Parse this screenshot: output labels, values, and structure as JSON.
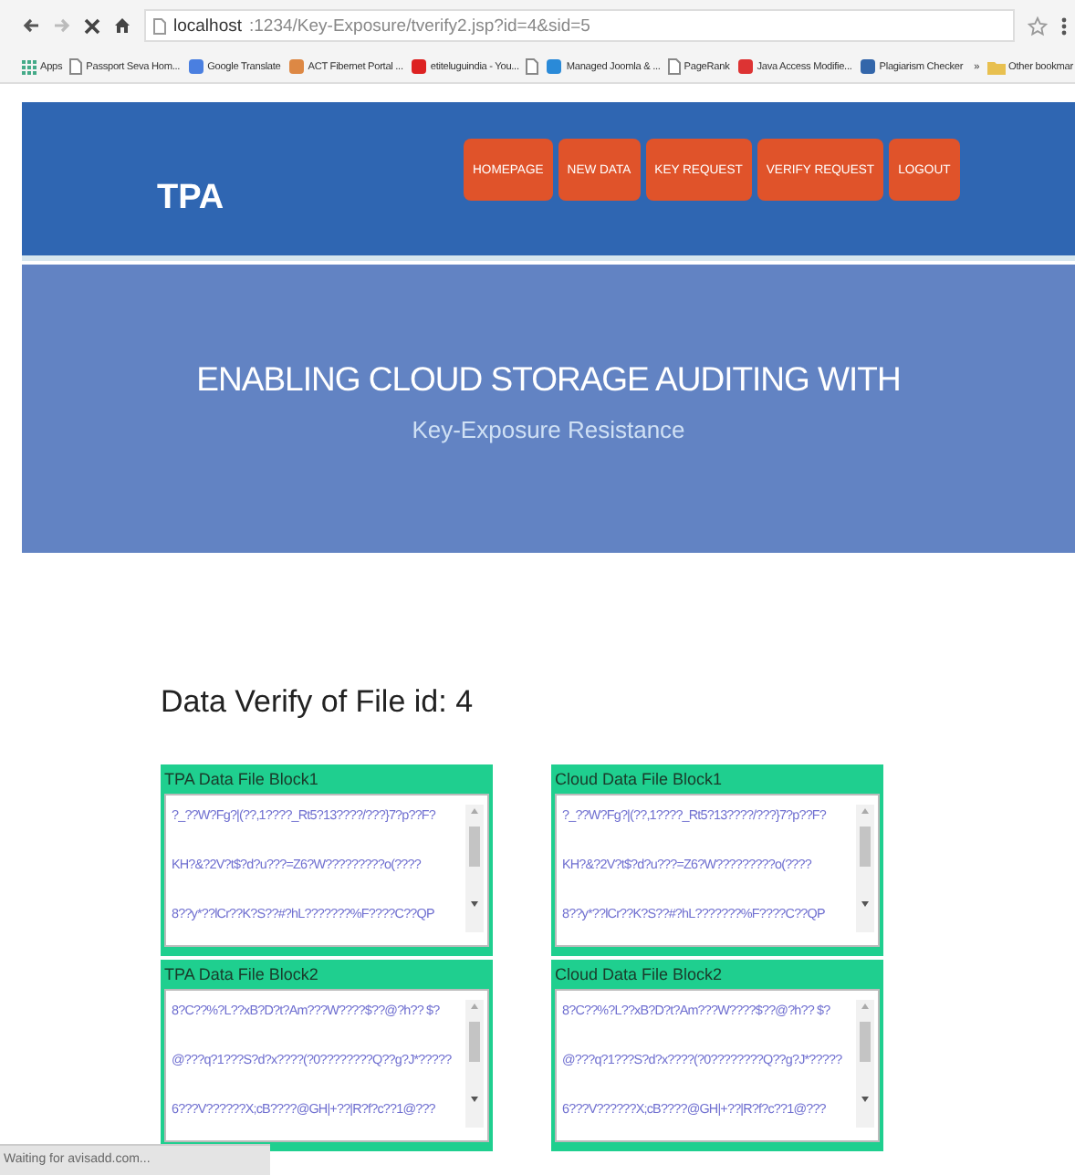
{
  "browser": {
    "address_host": "localhost",
    "address_path": ":1234/Key-Exposure/tverify2.jsp?id=4&sid=5",
    "bookmarks": [
      {
        "label": "Apps",
        "kind": "apps"
      },
      {
        "label": "Passport Seva Hom...",
        "kind": "page"
      },
      {
        "label": "Google Translate",
        "kind": "translate"
      },
      {
        "label": "ACT Fibernet Portal ...",
        "kind": "portal"
      },
      {
        "label": "etiteluguindia - You...",
        "kind": "video"
      },
      {
        "kind": "page"
      },
      {
        "label": "Managed Joomla & ...",
        "kind": "joomla"
      },
      {
        "label": "PageRank",
        "kind": "page"
      },
      {
        "label": "Java Access Modifie...",
        "kind": "java"
      },
      {
        "label": "Plagiarism Checker",
        "kind": "checker"
      }
    ],
    "overflow": "»",
    "other": "Other bookmar"
  },
  "header": {
    "brand": "TPA",
    "nav": [
      {
        "label": "HOMEPAGE"
      },
      {
        "label": "NEW DATA"
      },
      {
        "label": "KEY REQUEST"
      },
      {
        "label": "VERIFY REQUEST"
      },
      {
        "label": "LOGOUT"
      }
    ]
  },
  "hero": {
    "title": "ENABLING CLOUD STORAGE AUDITING WITH",
    "subtitle": "Key-Exposure Resistance"
  },
  "heading": "Data Verify of File id: 4",
  "blocks": [
    {
      "title": "TPA Data File Block1",
      "lines": [
        "?_??W?Fg?|(??,1????_Rt5?13????/???}7?p??F?",
        "KH?&?2V?t$?d?u???=Z6?W?????????o(????",
        "8??y*??lCr??K?S??#?hL???????%F????C??QP"
      ]
    },
    {
      "title": "Cloud Data File Block1",
      "lines": [
        "?_??W?Fg?|(??,1????_Rt5?13????/???}7?p??F?",
        "KH?&?2V?t$?d?u???=Z6?W?????????o(????",
        "8??y*??lCr??K?S??#?hL???????%F????C??QP"
      ]
    },
    {
      "title": "TPA Data File Block2",
      "lines": [
        "8?C??%?L??xB?D?t?Am???W????$??@?h??   $?",
        "@???q?1???S?d?x????(?0????????Q??g?J*?????",
        "6???V??????X;cB????@GH|+??|R?f?c??1@???"
      ]
    },
    {
      "title": "Cloud Data File Block2",
      "lines": [
        "8?C??%?L??xB?D?t?Am???W????$??@?h??   $?",
        "@???q?1???S?d?x????(?0????????Q??g?J*?????",
        "6???V??????X;cB????@GH|+??|R?f?c??1@???"
      ]
    }
  ],
  "status_bar": "Waiting for avisadd.com..."
}
